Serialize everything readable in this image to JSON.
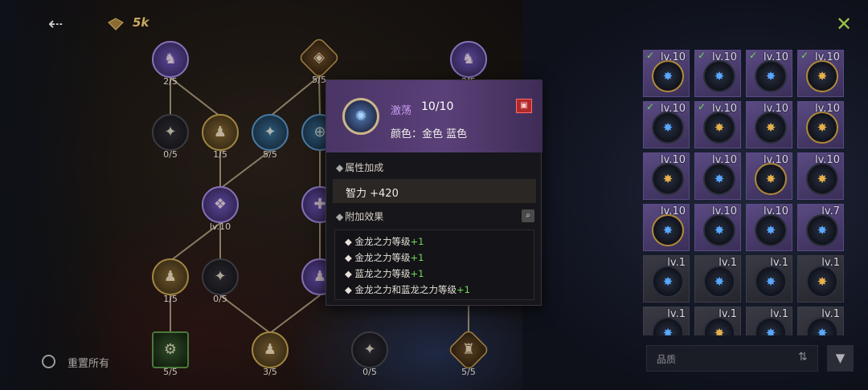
{
  "top_bar": {
    "currency_value": "5k"
  },
  "tree_nodes": [
    {
      "id": "n1",
      "count": "2/5",
      "style": "purple",
      "glyph": "♞"
    },
    {
      "id": "n2",
      "count": "5/5",
      "style": "hex",
      "glyph": "◈"
    },
    {
      "id": "n3",
      "count": "2/5",
      "style": "purple",
      "glyph": "♞"
    },
    {
      "id": "n4",
      "count": "0/5",
      "style": "dark",
      "glyph": "✦"
    },
    {
      "id": "n5",
      "count": "1/5",
      "style": "gold",
      "glyph": "♟"
    },
    {
      "id": "n6",
      "count": "5/5",
      "style": "blue",
      "glyph": "✦"
    },
    {
      "id": "n7",
      "count": "",
      "style": "blue",
      "glyph": "⊕"
    },
    {
      "id": "n8",
      "count": "lv.10",
      "style": "purple",
      "glyph": "❖"
    },
    {
      "id": "n9",
      "count": "",
      "style": "purple",
      "glyph": "✚"
    },
    {
      "id": "n10",
      "count": "1/5",
      "style": "gold",
      "glyph": "♟"
    },
    {
      "id": "n11",
      "count": "0/5",
      "style": "dark",
      "glyph": "✦"
    },
    {
      "id": "n12",
      "count": "",
      "style": "purple",
      "glyph": "♟"
    },
    {
      "id": "n13",
      "count": "5/5",
      "style": "green",
      "glyph": "⚙"
    },
    {
      "id": "n14",
      "count": "3/5",
      "style": "gold",
      "glyph": "♟"
    },
    {
      "id": "n15",
      "count": "0/5",
      "style": "dark",
      "glyph": "✦"
    },
    {
      "id": "n16",
      "count": "5/5",
      "style": "hex",
      "glyph": "♜"
    }
  ],
  "popup": {
    "name": "激荡",
    "level": "10/10",
    "colors": "颜色：金色 蓝色",
    "attr_title": "属性加成",
    "attr_value": "智力 +420",
    "effects_title": "附加效果",
    "effects": [
      {
        "text": "金龙之力等级",
        "bonus": "+1"
      },
      {
        "text": "金龙之力等级",
        "bonus": "+1"
      },
      {
        "text": "蓝龙之力等级",
        "bonus": "+1"
      },
      {
        "text": "金龙之力和蓝龙之力等级",
        "bonus": "+1"
      }
    ]
  },
  "inventory": [
    {
      "level": "lv.10",
      "rarity": "purple",
      "equipped": true,
      "ring": "gold",
      "color": "#58a8ff"
    },
    {
      "level": "lv.10",
      "rarity": "purple",
      "equipped": true,
      "ring": "dark",
      "color": "#58a8ff"
    },
    {
      "level": "lv.10",
      "rarity": "purple",
      "equipped": true,
      "ring": "dark",
      "color": "#58a8ff"
    },
    {
      "level": "lv.10",
      "rarity": "purple",
      "equipped": true,
      "ring": "gold",
      "color": "#e6b04a"
    },
    {
      "level": "lv.10",
      "rarity": "purple",
      "equipped": true,
      "ring": "dark",
      "color": "#58a8ff"
    },
    {
      "level": "lv.10",
      "rarity": "purple",
      "equipped": true,
      "ring": "dark",
      "color": "#e6b04a"
    },
    {
      "level": "lv.10",
      "rarity": "purple",
      "equipped": false,
      "ring": "dark",
      "color": "#e6b04a"
    },
    {
      "level": "lv.10",
      "rarity": "purple",
      "equipped": false,
      "ring": "gold",
      "color": "#e6b04a"
    },
    {
      "level": "lv.10",
      "rarity": "purple",
      "equipped": false,
      "ring": "dark",
      "color": "#e6b04a"
    },
    {
      "level": "lv.10",
      "rarity": "purple",
      "equipped": false,
      "ring": "dark",
      "color": "#58a8ff"
    },
    {
      "level": "lv.10",
      "rarity": "purple",
      "equipped": false,
      "ring": "gold",
      "color": "#e6b04a"
    },
    {
      "level": "lv.10",
      "rarity": "purple",
      "equipped": false,
      "ring": "dark",
      "color": "#e6b04a"
    },
    {
      "level": "lv.10",
      "rarity": "purple",
      "equipped": false,
      "ring": "gold",
      "color": "#58a8ff"
    },
    {
      "level": "lv.10",
      "rarity": "purple",
      "equipped": false,
      "ring": "dark",
      "color": "#58a8ff"
    },
    {
      "level": "lv.10",
      "rarity": "purple",
      "equipped": false,
      "ring": "dark",
      "color": "#58a8ff"
    },
    {
      "level": "lv.7",
      "rarity": "purple",
      "equipped": false,
      "ring": "dark",
      "color": "#58a8ff"
    },
    {
      "level": "lv.1",
      "rarity": "grey",
      "equipped": false,
      "ring": "dark",
      "color": "#58a8ff"
    },
    {
      "level": "lv.1",
      "rarity": "grey",
      "equipped": false,
      "ring": "dark",
      "color": "#58a8ff"
    },
    {
      "level": "lv.1",
      "rarity": "grey",
      "equipped": false,
      "ring": "dark",
      "color": "#58a8ff"
    },
    {
      "level": "lv.1",
      "rarity": "grey",
      "equipped": false,
      "ring": "dark",
      "color": "#e6b04a"
    },
    {
      "level": "lv.1",
      "rarity": "grey",
      "equipped": false,
      "ring": "dark",
      "color": "#58a8ff"
    },
    {
      "level": "lv.1",
      "rarity": "grey",
      "equipped": false,
      "ring": "dark",
      "color": "#e6b04a"
    },
    {
      "level": "lv.1",
      "rarity": "grey",
      "equipped": false,
      "ring": "dark",
      "color": "#58a8ff"
    },
    {
      "level": "lv.1",
      "rarity": "grey",
      "equipped": false,
      "ring": "dark",
      "color": "#58a8ff"
    }
  ],
  "bottom": {
    "reset_label": "重置所有",
    "quality_label": "品质"
  }
}
